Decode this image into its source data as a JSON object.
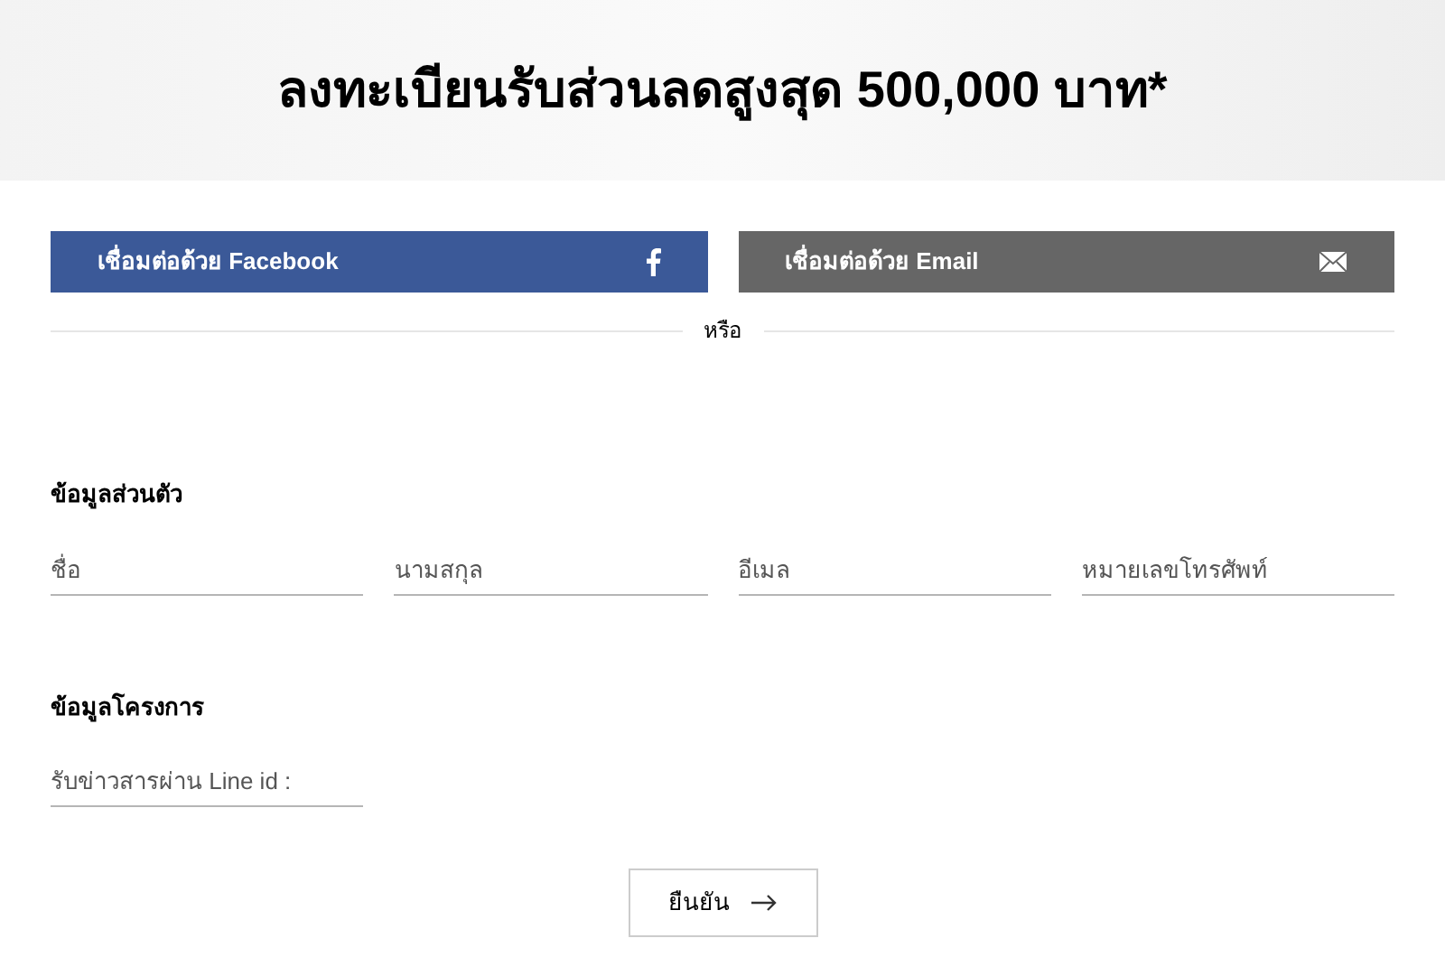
{
  "header": {
    "title": "ลงทะเบียนรับส่วนลดสูงสุด 500,000 บาท*"
  },
  "connect_buttons": [
    {
      "kind": "facebook",
      "label": "เชื่อมต่อด้วย Facebook"
    },
    {
      "kind": "email",
      "label": "เชื่อมต่อด้วย Email"
    }
  ],
  "divider": {
    "label": "หรือ"
  },
  "sections": [
    {
      "title": "ข้อมูลส่วนตัว",
      "fields": [
        {
          "placeholder": "ชื่อ"
        },
        {
          "placeholder": "นามสกุล"
        },
        {
          "placeholder": "อีเมล"
        },
        {
          "placeholder": "หมายเลขโทรศัพท์"
        }
      ]
    },
    {
      "title": "ข้อมูลโครงการ",
      "fields": [
        {
          "placeholder": "รับข่าวสารผ่าน Line id :"
        }
      ]
    }
  ],
  "submit": {
    "label": "ยืนยัน"
  }
}
